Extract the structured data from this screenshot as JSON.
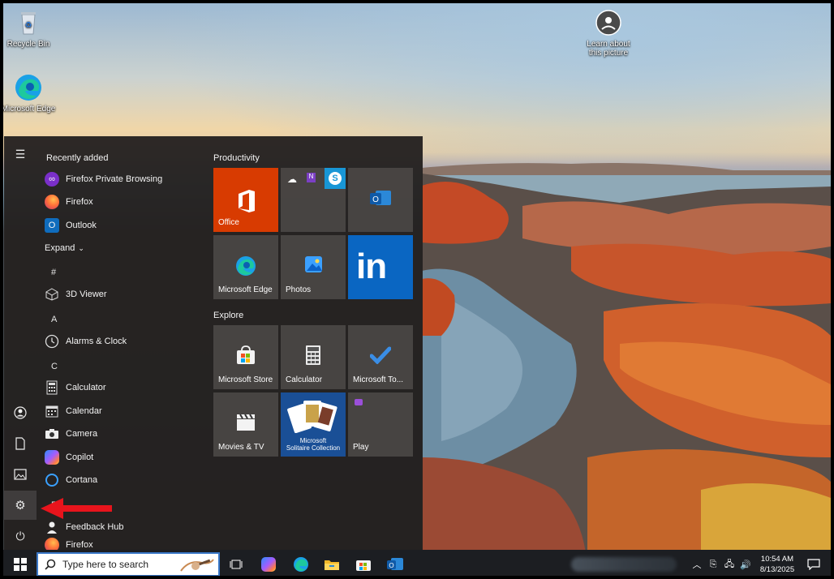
{
  "desktop": {
    "icons": [
      {
        "label": "Recycle Bin",
        "icon": "recycle-bin-icon"
      },
      {
        "label": "Microsoft Edge",
        "icon": "edge-icon"
      },
      {
        "label": "Learn about this picture",
        "icon": "camera-icon"
      }
    ]
  },
  "start_menu": {
    "recently_added_label": "Recently added",
    "recent_apps": [
      {
        "label": "Firefox Private Browsing",
        "icon": "firefox-private-icon"
      },
      {
        "label": "Firefox",
        "icon": "firefox-icon"
      },
      {
        "label": "Outlook",
        "icon": "outlook-icon"
      }
    ],
    "expand_label": "Expand",
    "groups": [
      {
        "letter": "#",
        "apps": [
          {
            "label": "3D Viewer",
            "icon": "cube-icon"
          }
        ]
      },
      {
        "letter": "A",
        "apps": [
          {
            "label": "Alarms & Clock",
            "icon": "clock-icon"
          }
        ]
      },
      {
        "letter": "C",
        "apps": [
          {
            "label": "Calculator",
            "icon": "calculator-icon"
          },
          {
            "label": "Calendar",
            "icon": "calendar-icon"
          },
          {
            "label": "Camera",
            "icon": "camera-icon"
          },
          {
            "label": "Copilot",
            "icon": "copilot-icon"
          },
          {
            "label": "Cortana",
            "icon": "cortana-icon"
          }
        ]
      },
      {
        "letter": "F",
        "apps": [
          {
            "label": "Feedback Hub",
            "icon": "feedback-icon"
          },
          {
            "label": "Firefox",
            "icon": "firefox-icon"
          }
        ]
      }
    ],
    "productivity_label": "Productivity",
    "explore_label": "Explore",
    "tiles": {
      "office": "Office",
      "edge": "Microsoft Edge",
      "photos": "Photos",
      "store": "Microsoft Store",
      "calculator": "Calculator",
      "todo": "Microsoft To...",
      "movies": "Movies & TV",
      "solitaire_line1": "Microsoft",
      "solitaire_line2": "Solitaire Collection",
      "play": "Play"
    },
    "rail_icons": [
      "hamburger-icon",
      "user-icon",
      "document-icon",
      "pictures-icon",
      "settings-icon",
      "power-icon"
    ]
  },
  "taskbar": {
    "search_placeholder": "Type here to search",
    "time": "10:54 AM",
    "date": "8/13/2025",
    "pinned": [
      "task-view-icon",
      "copilot-icon",
      "edge-icon",
      "file-explorer-icon",
      "store-icon",
      "outlook-icon"
    ]
  },
  "colors": {
    "accent": "#0078d4",
    "office": "#d83b01",
    "linkedin": "#0a66c2",
    "arrow": "#e8141c"
  }
}
